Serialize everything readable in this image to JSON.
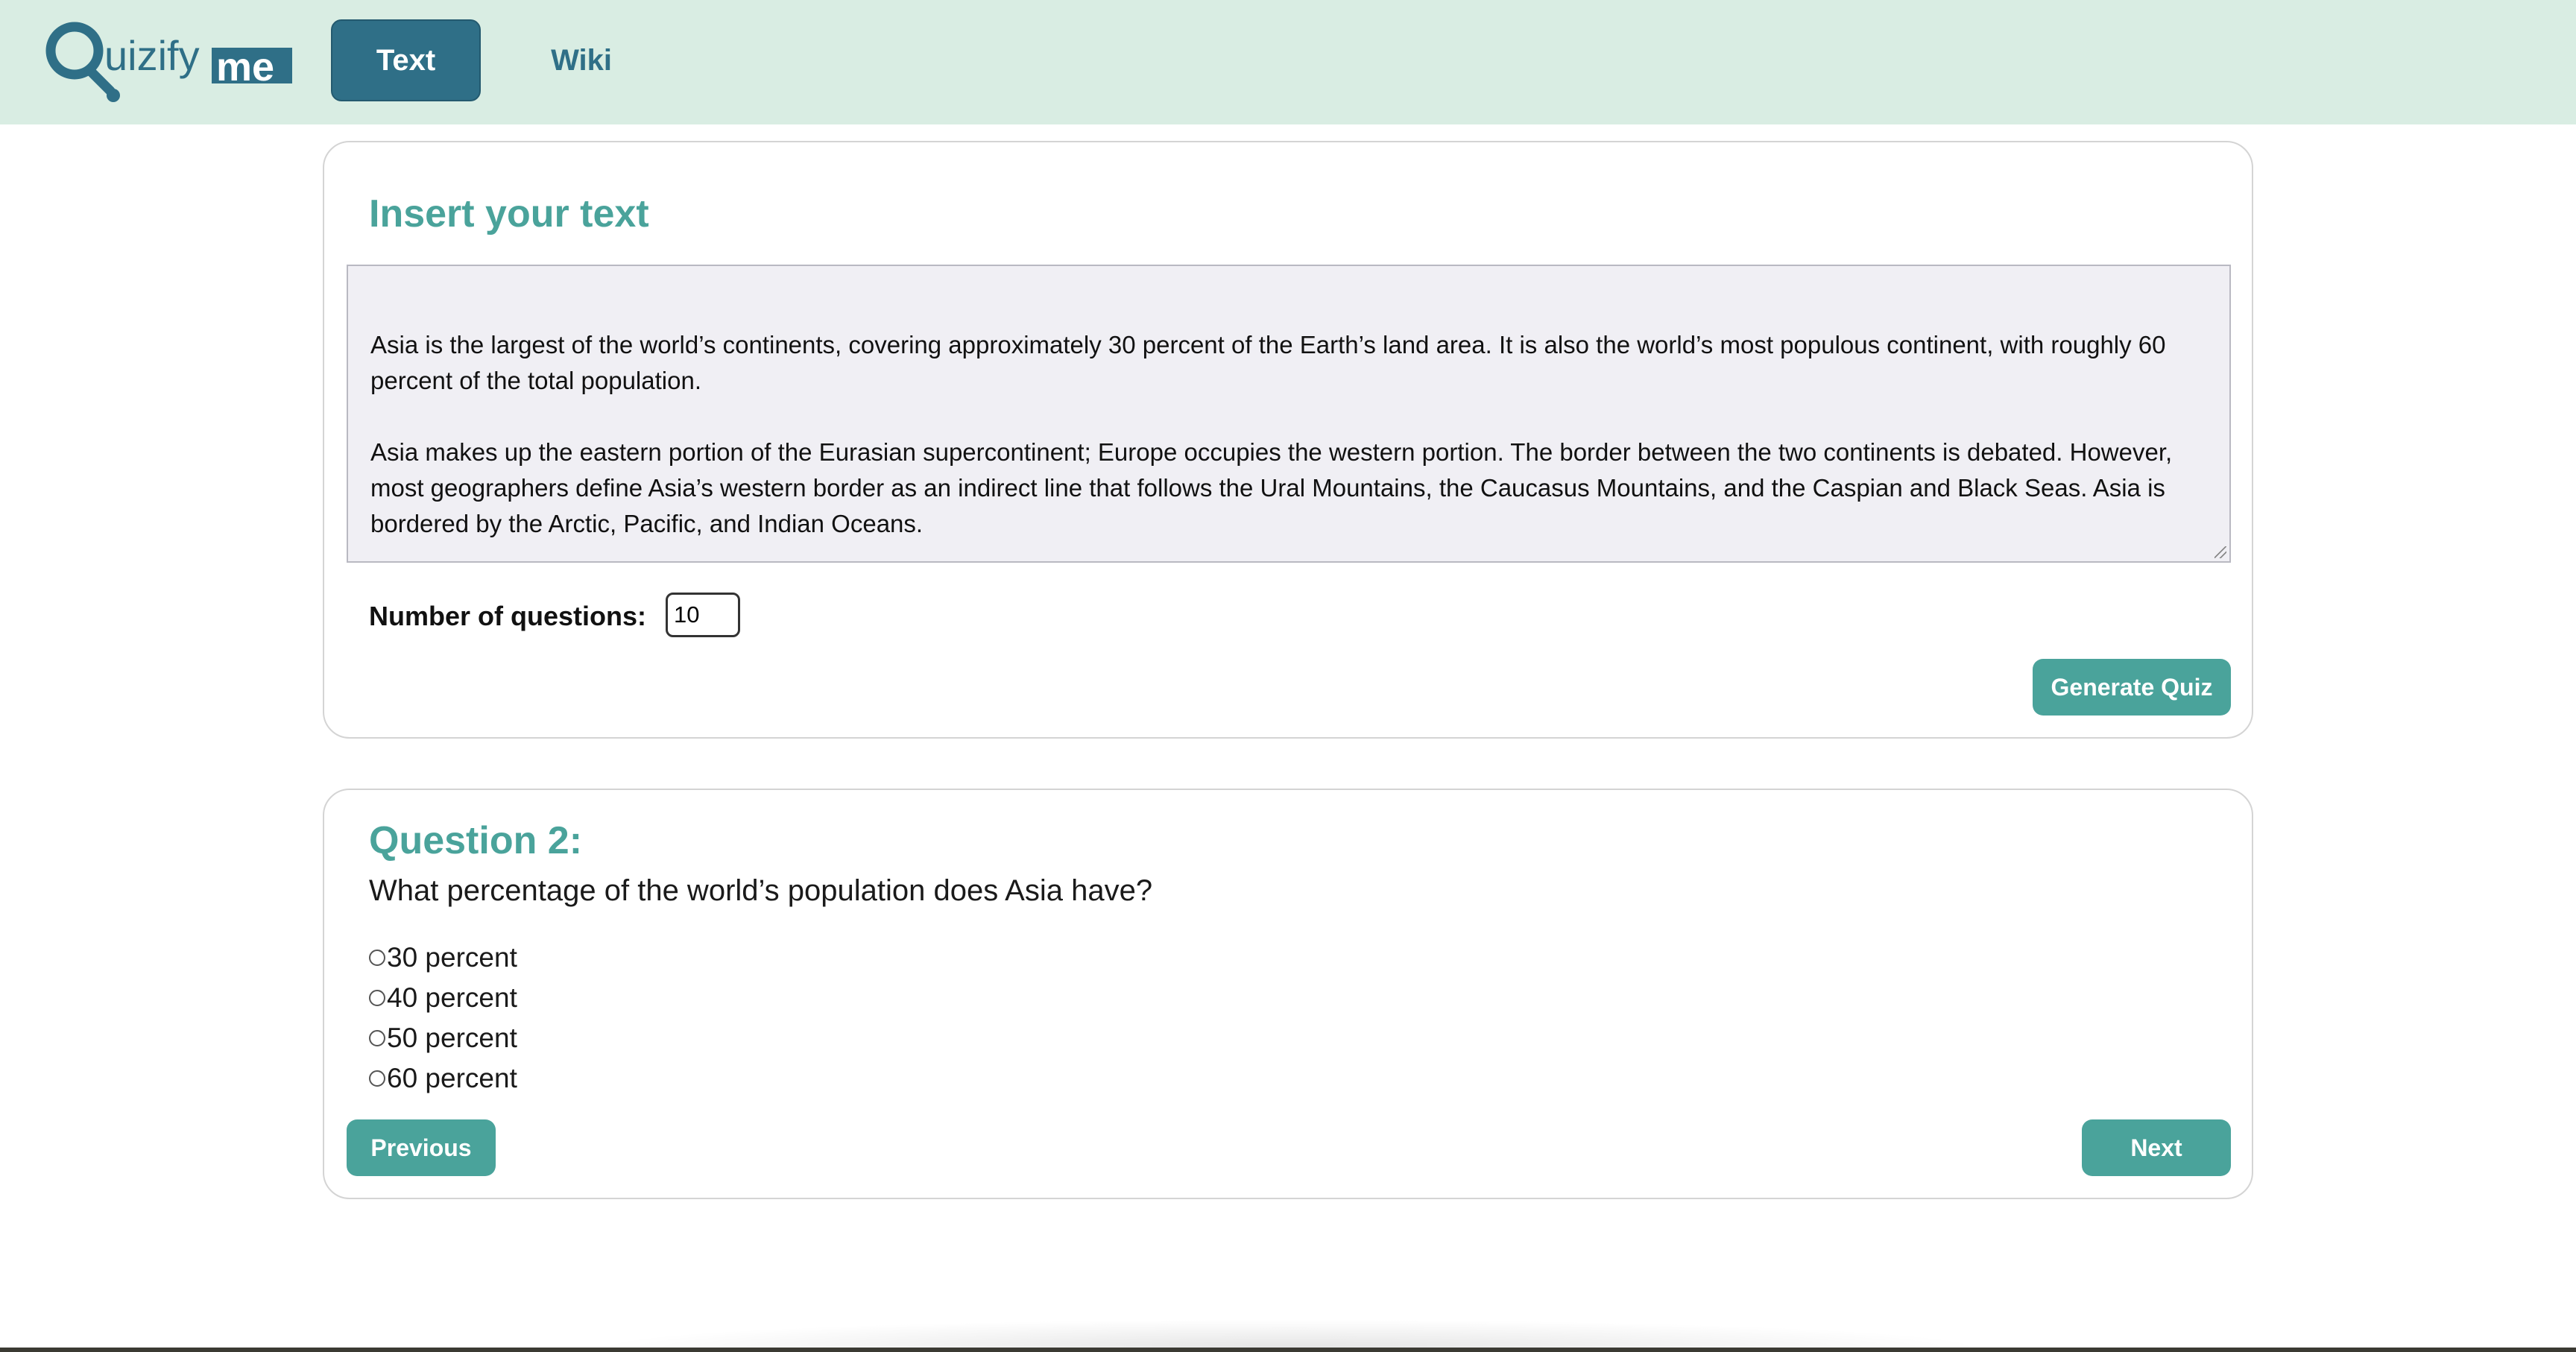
{
  "header": {
    "logo_text": "Quizifyme",
    "tabs": [
      {
        "label": "Text",
        "active": true
      },
      {
        "label": "Wiki",
        "active": false
      }
    ]
  },
  "input_card": {
    "title": "Insert your text",
    "paragraphs": [
      "Asia is the largest of the world’s continents, covering approximately 30 percent of the Earth’s land area. It is also the world’s most populous continent, with roughly 60 percent of the total population.",
      "Asia makes up the eastern portion of the Eurasian supercontinent; Europe occupies the western portion. The border between the two continents is debated. However, most geographers define Asia’s western border as an indirect line that follows the Ural Mountains, the Caucasus Mountains, and the Caspian and Black Seas. Asia is bordered by the Arctic, Pacific, and Indian Oceans."
    ],
    "num_questions_label": "Number of questions:",
    "num_questions_value": "10",
    "generate_label": "Generate Quiz"
  },
  "question_card": {
    "number_label": "Question 2:",
    "question": "What percentage of the world’s population does Asia have?",
    "options": [
      "30 percent",
      "40 percent",
      "50 percent",
      "60 percent"
    ],
    "previous_label": "Previous",
    "next_label": "Next"
  },
  "colors": {
    "header_bg": "#d9ede3",
    "brand_dark": "#2f6f87",
    "accent": "#4aa39b"
  }
}
